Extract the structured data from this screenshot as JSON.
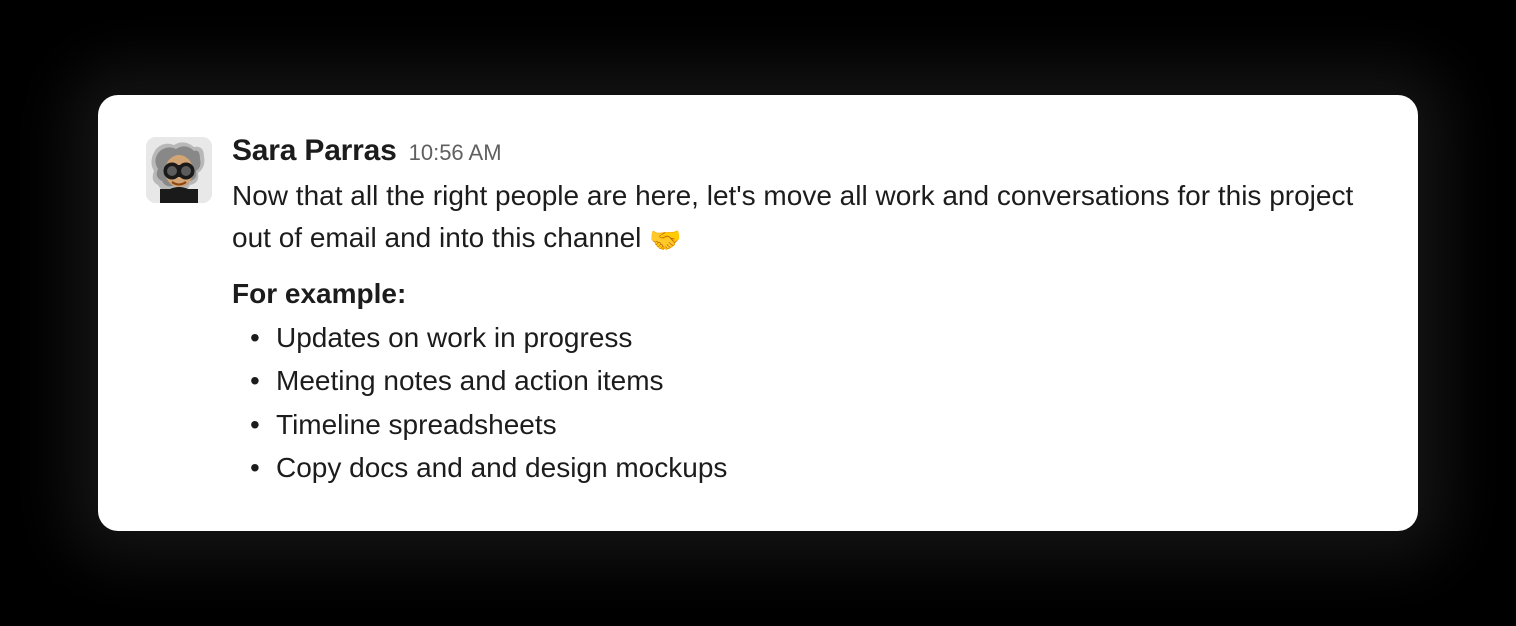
{
  "message": {
    "sender": "Sara Parras",
    "timestamp": "10:56 AM",
    "body": "Now that all the right people are here, let's move all work and conversations for this project out of email and into this channel ",
    "emoji": "🤝",
    "example_heading": "For example:",
    "examples": [
      "Updates on work in progress",
      "Meeting notes and action items",
      "Timeline spreadsheets",
      "Copy docs and and design mockups"
    ]
  }
}
